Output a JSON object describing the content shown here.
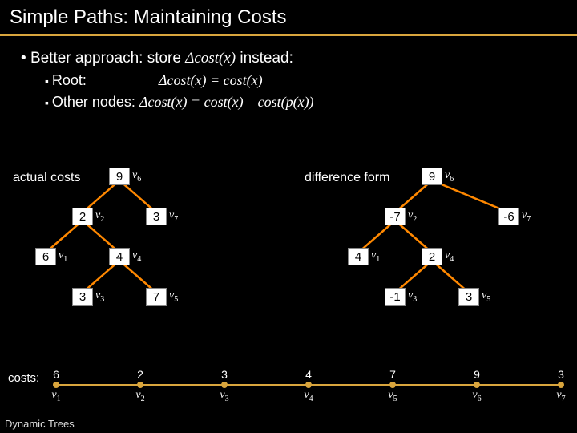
{
  "title": "Simple Paths: Maintaining Costs",
  "bullet": "Better approach: store ",
  "bullet_tail": " instead:",
  "dcost": "Δcost(x)",
  "sub1_label": "Root:",
  "sub1_eq_lhs": "Δcost(x) = ",
  "sub1_eq_rhs": "cost(x)",
  "sub2_label": "Other nodes: ",
  "sub2_eq": "Δcost(x) = cost(x) – cost(p(x))",
  "left_caption": "actual costs",
  "right_caption": "difference form",
  "left_tree": {
    "v6": "9",
    "v2": "2",
    "v7": "3",
    "v1": "6",
    "v4": "4",
    "v3": "3",
    "v5": "7"
  },
  "right_tree": {
    "v6": "9",
    "v2": "-7",
    "v7": "-6",
    "v1": "4",
    "v4": "2",
    "v3": "-1",
    "v5": "3"
  },
  "labels": {
    "v1": "v1",
    "v2": "v2",
    "v3": "v3",
    "v4": "v4",
    "v5": "v5",
    "v6": "v6",
    "v7": "v7"
  },
  "costs_label": "costs:",
  "costs": [
    {
      "v": "6",
      "l": "v1"
    },
    {
      "v": "2",
      "l": "v2"
    },
    {
      "v": "3",
      "l": "v3"
    },
    {
      "v": "4",
      "l": "v4"
    },
    {
      "v": "7",
      "l": "v5"
    },
    {
      "v": "9",
      "l": "v6"
    },
    {
      "v": "3",
      "l": "v7"
    }
  ],
  "footer": "Dynamic Trees"
}
